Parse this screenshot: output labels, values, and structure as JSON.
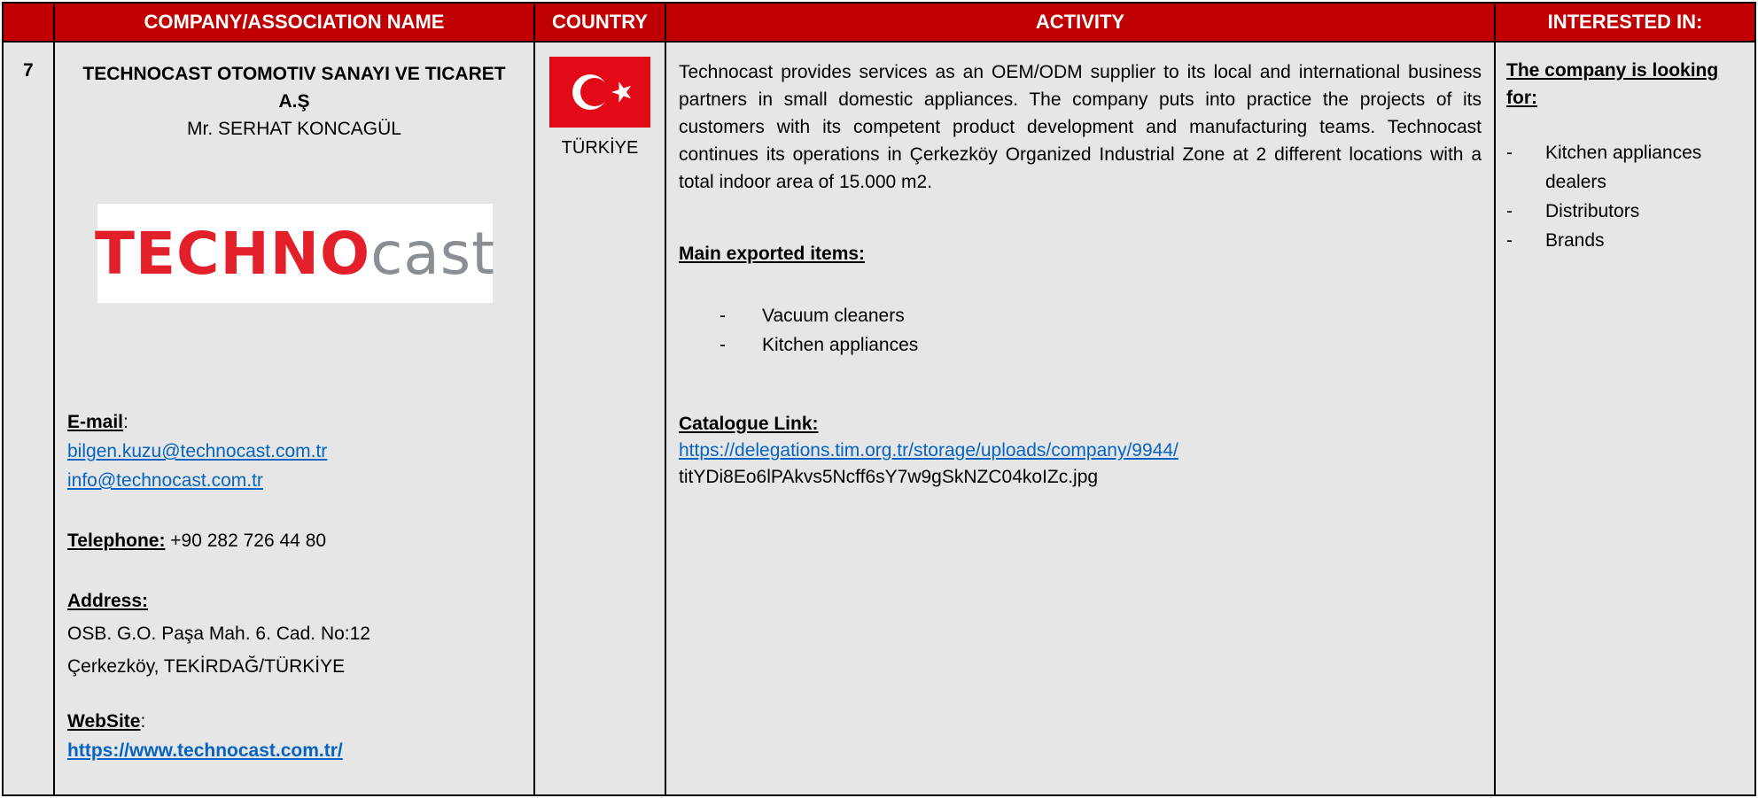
{
  "headers": {
    "col1": "",
    "col2": "COMPANY/ASSOCIATION NAME",
    "col3": "COUNTRY",
    "col4": "ACTIVITY",
    "col5": "INTERESTED IN:"
  },
  "row": {
    "number": "7",
    "company": {
      "name_line1": "TECHNOCAST OTOMOTIV SANAYI VE TICARET",
      "name_line2": "A.Ş",
      "contact_person": "Mr. SERHAT KONCAGÜL",
      "logo_text_red": "TECHNO",
      "logo_text_grey": "cast",
      "email_label": "E-mail",
      "email_suffix": ":",
      "emails": [
        "bilgen.kuzu@technocast.com.tr",
        "info@technocast.com.tr"
      ],
      "telephone_label": "Telephone:",
      "telephone_value": "+90 282 726 44 80",
      "address_label": "Address:",
      "address_line1": "OSB. G.O. Paşa Mah. 6. Cad. No:12",
      "address_line2": "Çerkezköy, TEKİRDAĞ/TÜRKİYE",
      "website_label": "WebSite",
      "website_suffix": ":",
      "website_url": "https://www.technocast.com.tr/"
    },
    "country": {
      "name": "TÜRKİYE",
      "flag_colors": {
        "red": "#e30a17",
        "white": "#ffffff"
      }
    },
    "activity": {
      "description": "Technocast provides services as an OEM/ODM supplier to its local and international business partners in small domestic appliances. The company puts into practice the projects of its customers with its competent product development and manufacturing teams. Technocast continues its operations in Çerkezköy Organized Industrial Zone at 2 different locations with a total indoor area of 15.000 m2.",
      "exported_label": "Main exported items:",
      "exported_items": [
        "Vacuum cleaners",
        "Kitchen appliances"
      ],
      "catalogue_label": "Catalogue Link:",
      "catalogue_url": "https://delegations.tim.org.tr/storage/uploads/company/9944/",
      "catalogue_file": "titYDi8Eo6lPAkvs5Ncff6sY7w9gSkNZC04koIZc.jpg"
    },
    "interested": {
      "heading_line1": "The company is looking",
      "heading_line2": "for:",
      "items": [
        "Kitchen appliances dealers",
        "Distributors",
        "Brands"
      ]
    }
  },
  "colors": {
    "header_bg": "#c00000",
    "cell_bg": "#e6e6e6",
    "link": "#0563c1"
  }
}
